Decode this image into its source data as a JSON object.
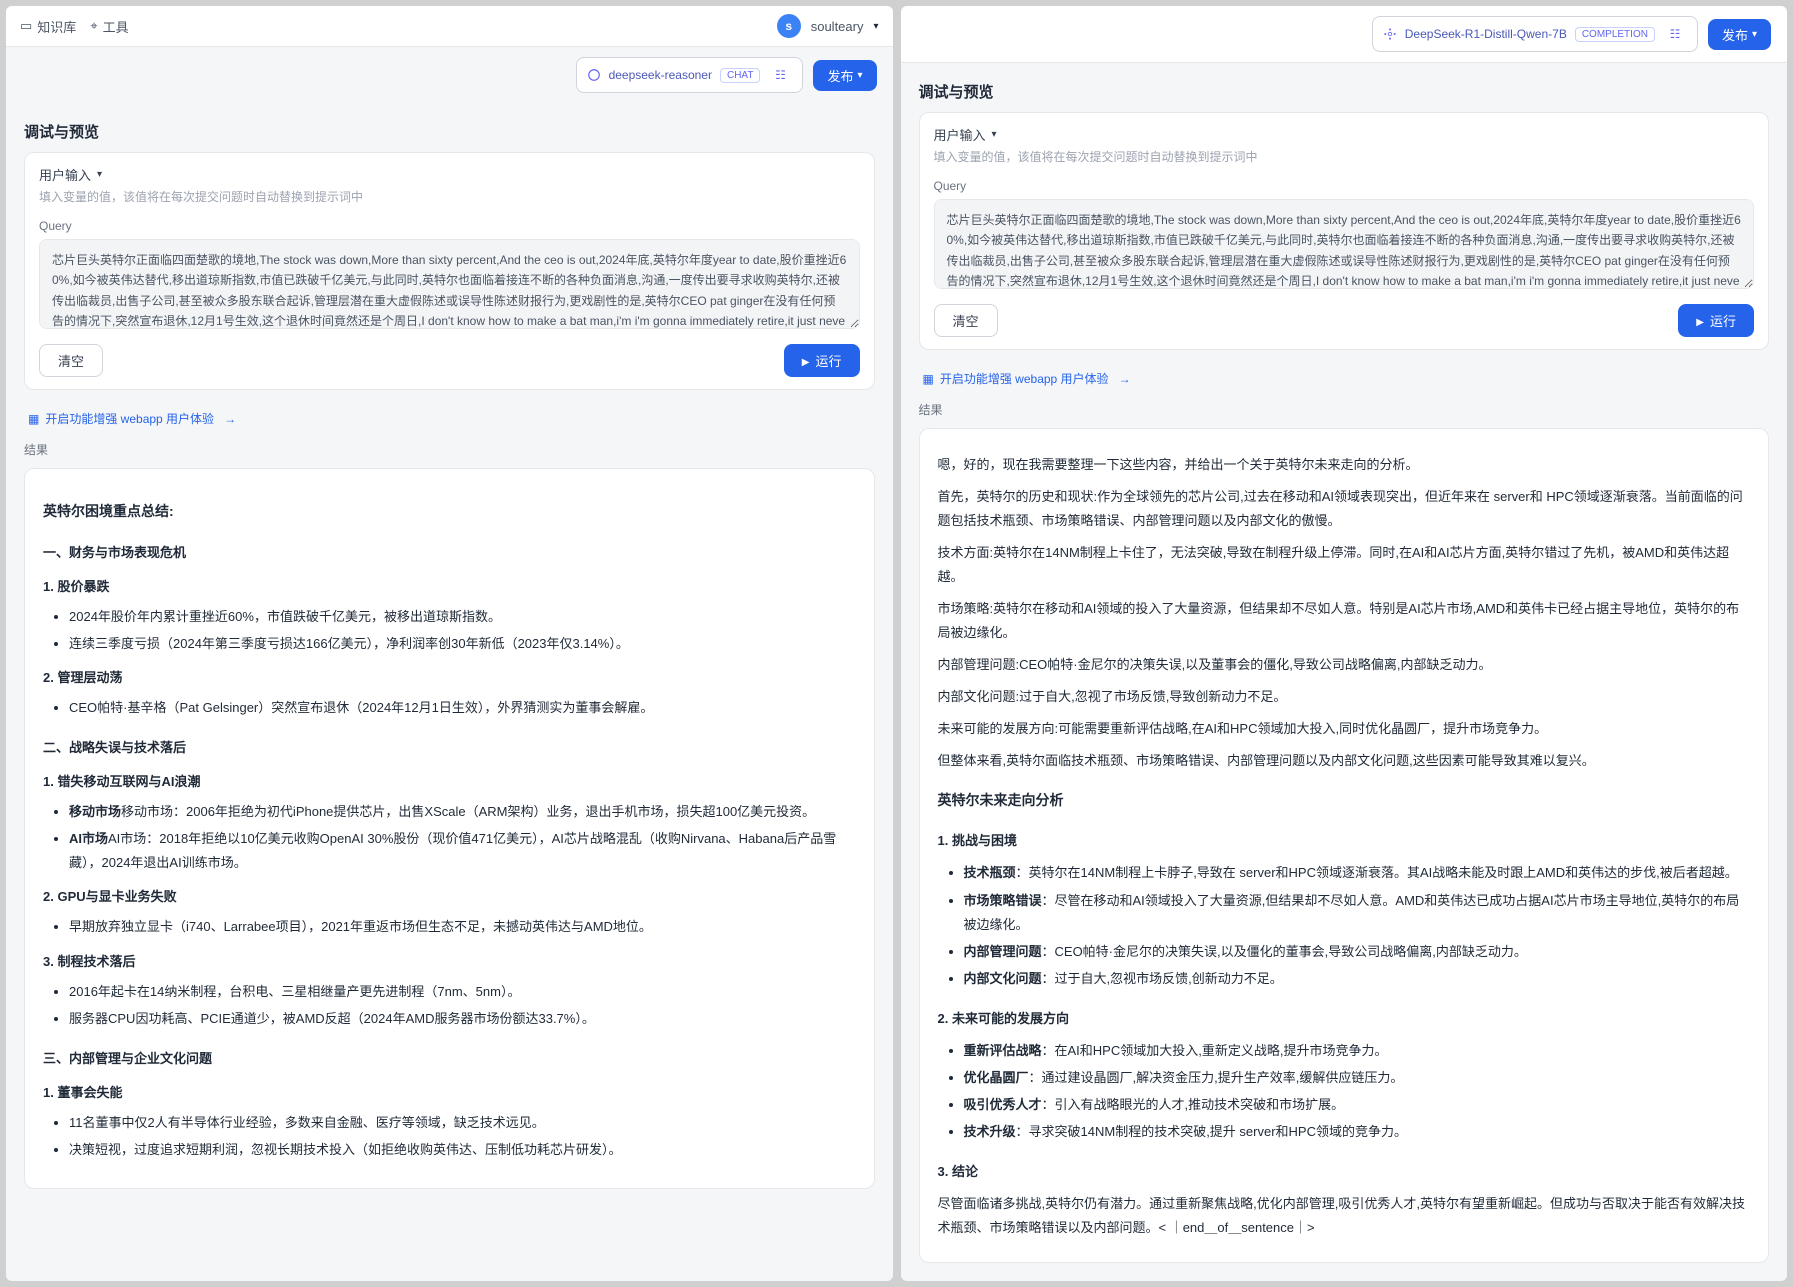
{
  "left": {
    "topbar": {
      "knowledge": "知识库",
      "tools": "工具",
      "avatar_letter": "s",
      "username": "soulteary"
    },
    "model": {
      "name": "deepseek-reasoner",
      "tag": "CHAT",
      "publish": "发布"
    },
    "section_title": "调试与预览",
    "user_input_label": "用户输入",
    "hint": "填入变量的值，该值将在每次提交问题时自动替换到提示词中",
    "query_label": "Query",
    "query_text": "芯片巨头英特尔正面临四面楚歌的境地,The stock was down,More than sixty percent,And the ceo is out,2024年底,英特尔年度year to date,股价重挫近60%,如今被英伟达替代,移出道琼斯指数,市值已跌破千亿美元,与此同时,英特尔也面临着接连不断的各种负面消息,沟通,一度传出要寻求收购英特尔,还被传出临裁员,出售子公司,甚至被众多股东联合起诉,管理层潜在重大虚假陈述或误导性陈述财报行为,更戏剧性的是,英特尔CEO pat ginger在没有任何预告的情况下,突然宣布退休,12月1号生效,这个退休时间竟然还是个周日,I don't know how to make a bat man,i'm i'm gonna immediately retire,it just never sounds,good doesn't pad的退休是被迫还是主动呢,这里面还挺有门道的哈,我们在视频中稍后会详细分析到,英特尔从1991年到现在,已经连续30多年霸榜PC市场榜单第一的位置,市场占有率一度超过80%,作为芯片行业的一代引领者,却接连错过了移动化与AI的浪潮,落到如今的处境,难免令",
    "clear": "清空",
    "run": "运行",
    "enhance": "开启功能增强 webapp 用户体验",
    "result_label": "结果",
    "result": {
      "title": "英特尔困境重点总结:",
      "s1": {
        "h": "一、财务与市场表现危机",
        "p1": {
          "h": "1. 股价暴跌",
          "b1": "2024年股价年内累计重挫近60%，市值跌破千亿美元，被移出道琼斯指数。",
          "b2": "连续三季度亏损（2024年第三季度亏损达166亿美元），净利润率创30年新低（2023年仅3.14%）。"
        },
        "p2": {
          "h": "2. 管理层动荡",
          "b1": "CEO帕特·基辛格（Pat Gelsinger）突然宣布退休（2024年12月1日生效），外界猜测实为董事会解雇。"
        }
      },
      "s2": {
        "h": "二、战略失误与技术落后",
        "p1": {
          "h": "1. 错失移动互联网与AI浪潮",
          "b1": "移动市场：2006年拒绝为初代iPhone提供芯片，出售XScale（ARM架构）业务，退出手机市场，损失超100亿美元投资。",
          "b2": "AI市场：2018年拒绝以10亿美元收购OpenAI 30%股份（现价值471亿美元），AI芯片战略混乱（收购Nirvana、Habana后产品雪藏），2024年退出AI训练市场。"
        },
        "p2": {
          "h": "2. GPU与显卡业务失败",
          "b1": "早期放弃独立显卡（i740、Larrabee项目），2021年重返市场但生态不足，未撼动英伟达与AMD地位。"
        },
        "p3": {
          "h": "3. 制程技术落后",
          "b1": "2016年起卡在14纳米制程，台积电、三星相继量产更先进制程（7nm、5nm）。",
          "b2": "服务器CPU因功耗高、PCIE通道少，被AMD反超（2024年AMD服务器市场份额达33.7%）。"
        }
      },
      "s3": {
        "h": "三、内部管理与企业文化问题",
        "p1": {
          "h": "1. 董事会失能",
          "b1": "11名董事中仅2人有半导体行业经验，多数来自金融、医疗等领域，缺乏技术远见。",
          "b2": "决策短视，过度追求短期利润，忽视长期技术投入（如拒绝收购英伟达、压制低功耗芯片研发）。"
        }
      }
    }
  },
  "right": {
    "model": {
      "name": "DeepSeek-R1-Distill-Qwen-7B",
      "tag": "COMPLETION",
      "publish": "发布"
    },
    "section_title": "调试与预览",
    "user_input_label": "用户输入",
    "hint": "填入变量的值，该值将在每次提交问题时自动替换到提示词中",
    "query_label": "Query",
    "query_text": "芯片巨头英特尔正面临四面楚歌的境地,The stock was down,More than sixty percent,And the ceo is out,2024年底,英特尔年度year to date,股价重挫近60%,如今被英伟达替代,移出道琼斯指数,市值已跌破千亿美元,与此同时,英特尔也面临着接连不断的各种负面消息,沟通,一度传出要寻求收购英特尔,还被传出临裁员,出售子公司,甚至被众多股东联合起诉,管理层潜在重大虚假陈述或误导性陈述财报行为,更戏剧性的是,英特尔CEO pat ginger在没有任何预告的情况下,突然宣布退休,12月1号生效,这个退休时间竟然还是个周日,I don't know how to make a bat man,i'm i'm gonna immediately retire,it just never sounds,good doesn't pad的退休是被迫还是主动呢,这里面还挺有门道的哈,我们在视频中稍后会详细分析到,英特尔从1991年到现在,已经连续30多年霸榜PC市场榜单第一的位置,市场占有率一度超过80%,作为芯片行业的一代引领者,却接连错过了移动化与AI的浪潮,落到如今的处境,难免令",
    "clear": "清空",
    "run": "运行",
    "enhance": "开启功能增强 webapp 用户体验",
    "result_label": "结果",
    "flow": {
      "p1": "嗯，好的，现在我需要整理一下这些内容，并给出一个关于英特尔未来走向的分析。",
      "p2": "首先，英特尔的历史和现状:作为全球领先的芯片公司,过去在移动和AI领域表现突出，但近年来在 server和 HPC领域逐渐衰落。当前面临的问题包括技术瓶颈、市场策略错误、内部管理问题以及内部文化的傲慢。",
      "p3": "技术方面:英特尔在14NM制程上卡住了，无法突破,导致在制程升级上停滞。同时,在AI和AI芯片方面,英特尔错过了先机，被AMD和英伟达超越。",
      "p4": "市场策略:英特尔在移动和AI领域的投入了大量资源，但结果却不尽如人意。特别是AI芯片市场,AMD和英伟卡已经占据主导地位，英特尔的布局被边缘化。",
      "p5": "内部管理问题:CEO帕特·金尼尔的决策失误,以及董事会的僵化,导致公司战略偏离,内部缺乏动力。",
      "p6": "内部文化问题:过于自大,忽视了市场反馈,导致创新动力不足。",
      "p7": "未来可能的发展方向:可能需要重新评估战略,在AI和HPC领域加大投入,同时优化晶圆厂，提升市场竞争力。",
      "p8": "但整体来看,英特尔面临技术瓶颈、市场策略错误、内部管理问题以及内部文化问题,这些因素可能导致其难以复兴。"
    },
    "analysis": {
      "title": "英特尔未来走向分析",
      "s1": {
        "h": "1. 挑战与困境",
        "b1t": "技术瓶颈",
        "b1": "：英特尔在14NM制程上卡脖子,导致在 server和HPC领域逐渐衰落。其AI战略未能及时跟上AMD和英伟达的步伐,被后者超越。",
        "b2t": "市场策略错误",
        "b2": "：尽管在移动和AI领域投入了大量资源,但结果却不尽如人意。AMD和英伟达已成功占据AI芯片市场主导地位,英特尔的布局被边缘化。",
        "b3t": "内部管理问题",
        "b3": "：CEO帕特·金尼尔的决策失误,以及僵化的董事会,导致公司战略偏离,内部缺乏动力。",
        "b4t": "内部文化问题",
        "b4": "：过于自大,忽视市场反馈,创新动力不足。"
      },
      "s2": {
        "h": "2. 未来可能的发展方向",
        "b1t": "重新评估战略",
        "b1": "：在AI和HPC领域加大投入,重新定义战略,提升市场竞争力。",
        "b2t": "优化晶圆厂",
        "b2": "：通过建设晶圆厂,解决资金压力,提升生产效率,缓解供应链压力。",
        "b3t": "吸引优秀人才",
        "b3": "：引入有战略眼光的人才,推动技术突破和市场扩展。",
        "b4t": "技术升级",
        "b4": "：寻求突破14NM制程的技术突破,提升 server和HPC领域的竞争力。"
      },
      "s3": {
        "h": "3. 结论",
        "p": "尽管面临诸多挑战,英特尔仍有潜力。通过重新聚焦战略,优化内部管理,吸引优秀人才,英特尔有望重新崛起。但成功与否取决于能否有效解决技术瓶颈、市场策略错误以及内部问题。< ｜end＿of＿sentence｜>"
      }
    }
  }
}
